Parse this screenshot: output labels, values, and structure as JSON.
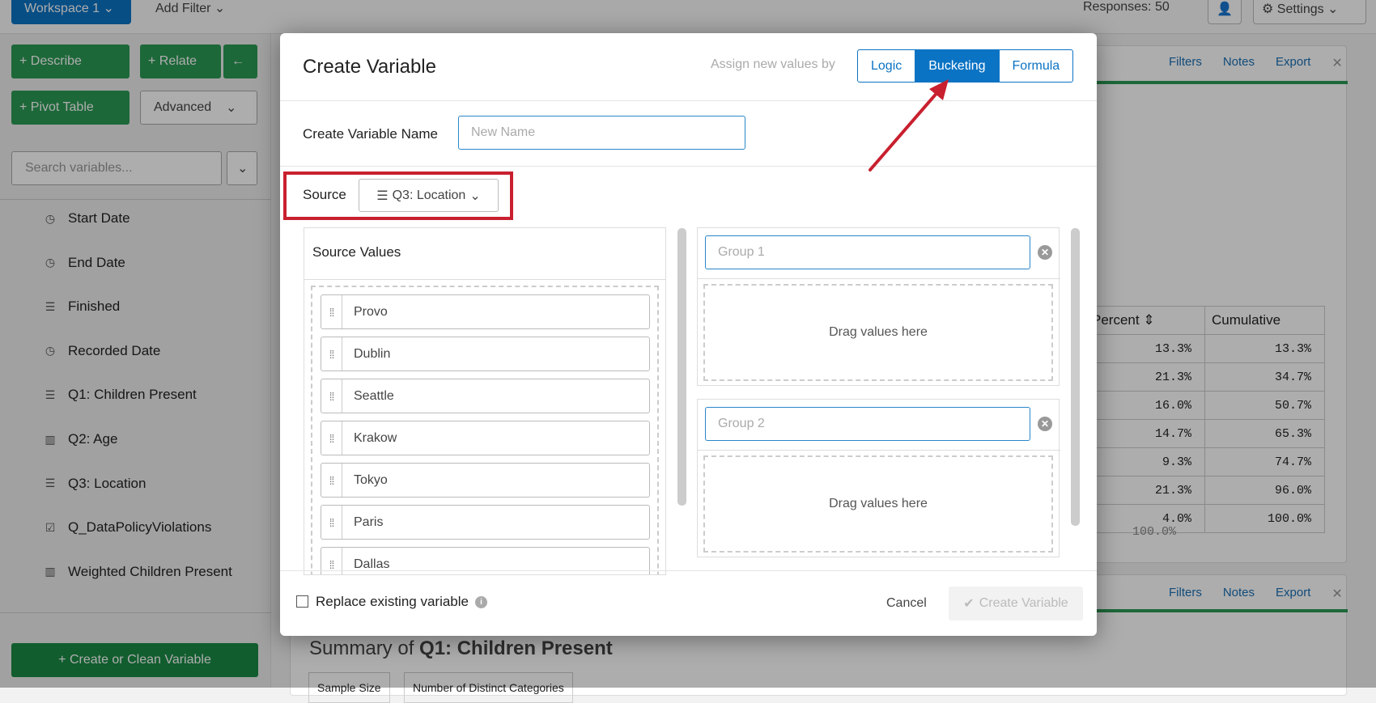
{
  "topbar": {
    "workspace": "Workspace 1",
    "add_filter": "Add Filter",
    "responses": "Responses: 50",
    "settings": "Settings"
  },
  "sidebar": {
    "describe": "Describe",
    "relate": "Relate",
    "pivot": "Pivot Table",
    "advanced": "Advanced",
    "search_placeholder": "Search variables...",
    "create_clean": "Create or Clean Variable",
    "items": [
      {
        "label": "Start Date",
        "icon": "clock-icon"
      },
      {
        "label": "End Date",
        "icon": "clock-icon"
      },
      {
        "label": "Finished",
        "icon": "list-icon"
      },
      {
        "label": "Recorded Date",
        "icon": "clock-icon"
      },
      {
        "label": "Q1: Children Present",
        "icon": "list-icon"
      },
      {
        "label": "Q2: Age",
        "icon": "bar-chart-icon"
      },
      {
        "label": "Q3: Location",
        "icon": "list-icon"
      },
      {
        "label": "Q_DataPolicyViolations",
        "icon": "checkbox-icon"
      },
      {
        "label": "Weighted Children Present",
        "icon": "bar-chart-icon"
      }
    ]
  },
  "background": {
    "card_links": [
      "Filters",
      "Notes",
      "Export"
    ],
    "table_headers": [
      "Percent",
      "Cumulative"
    ],
    "percent": [
      "13.3%",
      "21.3%",
      "16.0%",
      "14.7%",
      "9.3%",
      "21.3%",
      "4.0%"
    ],
    "cumulative": [
      "13.3%",
      "34.7%",
      "50.7%",
      "65.3%",
      "74.7%",
      "96.0%",
      "100.0%"
    ],
    "total": "100.0%",
    "summary_prefix": "Summary of ",
    "summary_var": "Q1: Children Present",
    "sub_headers": [
      "Sample Size",
      "Number of Distinct Categories"
    ]
  },
  "modal": {
    "title": "Create Variable",
    "assign_label": "Assign new values by",
    "modes": [
      "Logic",
      "Bucketing",
      "Formula"
    ],
    "name_label": "Create Variable Name",
    "name_placeholder": "New Name",
    "source_label": "Source",
    "source_value": "Q3: Location",
    "source_values_title": "Source Values",
    "values": [
      "Provo",
      "Dublin",
      "Seattle",
      "Krakow",
      "Tokyo",
      "Paris",
      "Dallas"
    ],
    "groups": [
      {
        "placeholder": "Group 1",
        "drop": "Drag values here"
      },
      {
        "placeholder": "Group 2",
        "drop": "Drag values here"
      }
    ],
    "replace_label": "Replace existing variable",
    "cancel": "Cancel",
    "create": "Create Variable"
  },
  "colors": {
    "accent": "#0b73c4",
    "green": "#2c9a55",
    "annotation": "#c8202f"
  }
}
